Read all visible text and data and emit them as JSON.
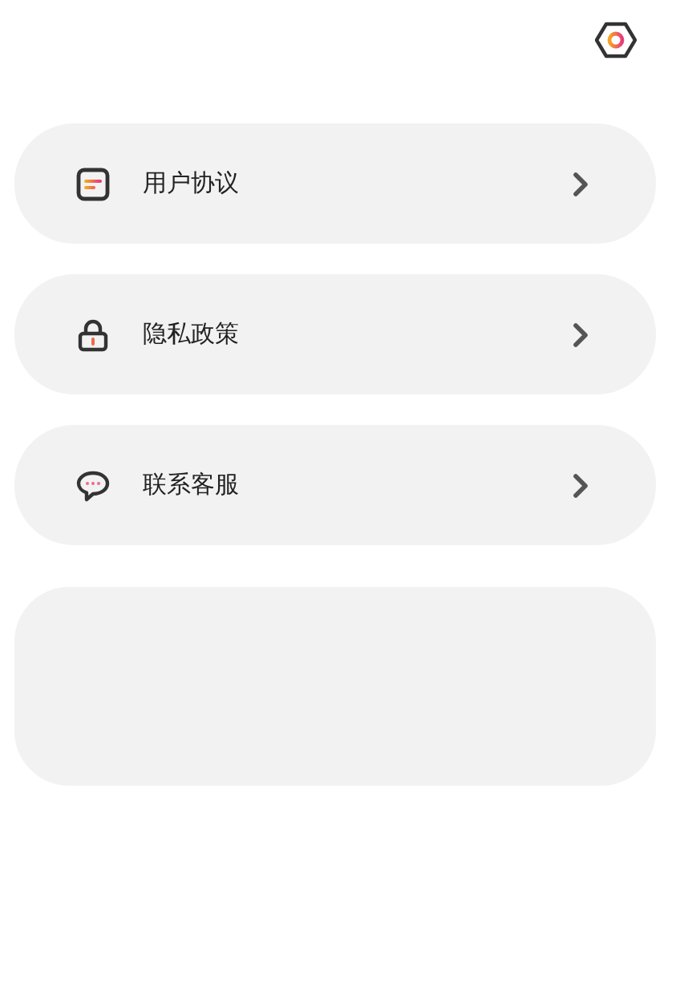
{
  "menu": [
    {
      "kind": "document",
      "label": "用户协议"
    },
    {
      "kind": "lock",
      "label": "隐私政策"
    },
    {
      "kind": "chat",
      "label": "联系客服"
    }
  ]
}
